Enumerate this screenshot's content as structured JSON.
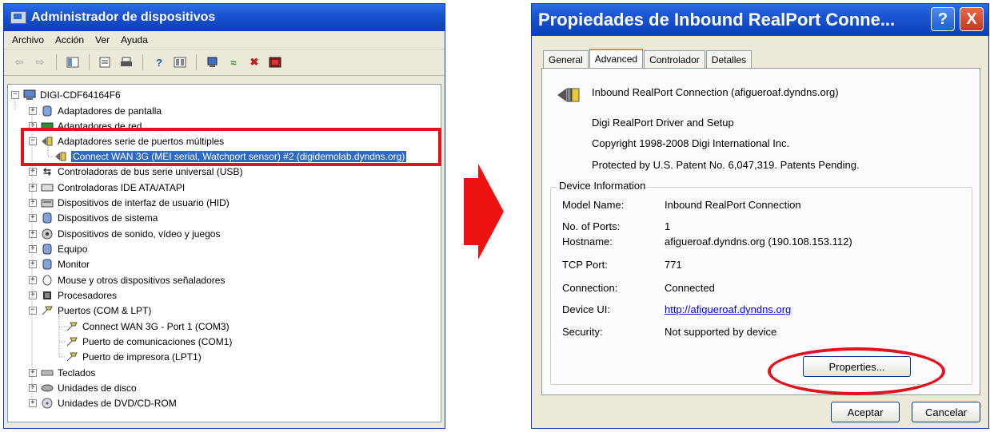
{
  "device_manager": {
    "title": "Administrador de dispositivos",
    "menu": [
      "Archivo",
      "Acción",
      "Ver",
      "Ayuda"
    ],
    "tree": {
      "root": "DIGI-CDF64164F6",
      "items": [
        "Adaptadores de pantalla",
        "Adaptadores de red",
        "Adaptadores serie de puertos múltiples",
        "Connect WAN 3G (MEI serial, Watchport sensor) #2 (digidemolab.dyndns.org)",
        "Controladoras de bus serie universal (USB)",
        "Controladoras IDE ATA/ATAPI",
        "Dispositivos de interfaz de usuario (HID)",
        "Dispositivos de sistema",
        "Dispositivos de sonido, vídeo y juegos",
        "Equipo",
        "Monitor",
        "Mouse y otros dispositivos señaladores",
        "Procesadores",
        "Puertos (COM & LPT)",
        "Connect WAN 3G - Port 1 (COM3)",
        "Puerto de comunicaciones (COM1)",
        "Puerto de impresora (LPT1)",
        "Teclados",
        "Unidades de disco",
        "Unidades de DVD/CD-ROM"
      ]
    }
  },
  "properties_dialog": {
    "title": "Propiedades de Inbound RealPort Conne...",
    "title_help": "?",
    "title_close": "X",
    "tabs": [
      "General",
      "Advanced",
      "Controlador",
      "Detalles"
    ],
    "device_name": "Inbound RealPort Connection (afigueroaf.dyndns.org)",
    "driver": "Digi RealPort Driver and Setup",
    "copyright": "Copyright 1998-2008 Digi International Inc.",
    "patent": "Protected by U.S. Patent No. 6,047,319. Patents Pending.",
    "group_title": "Device Information",
    "info": [
      {
        "label": "Model Name:",
        "value": "Inbound RealPort Connection"
      },
      {
        "label": "No. of Ports:",
        "value": "1"
      },
      {
        "label": "Hostname:",
        "value": "afigueroaf.dyndns.org (190.108.153.112)"
      },
      {
        "label": "TCP Port:",
        "value": "771"
      },
      {
        "label": "Connection:",
        "value": "Connected"
      },
      {
        "label": "Device UI:",
        "value": "http://afigueroaf.dyndns.org"
      },
      {
        "label": "Security:",
        "value": "Not supported by device"
      }
    ],
    "properties_button": "Properties...",
    "ok_button": "Aceptar",
    "cancel_button": "Cancelar"
  },
  "colors": {
    "highlight": "#e3121c",
    "arrow": "#ee1111",
    "titlebar": "#1c56d4",
    "selection": "#316ac5"
  }
}
